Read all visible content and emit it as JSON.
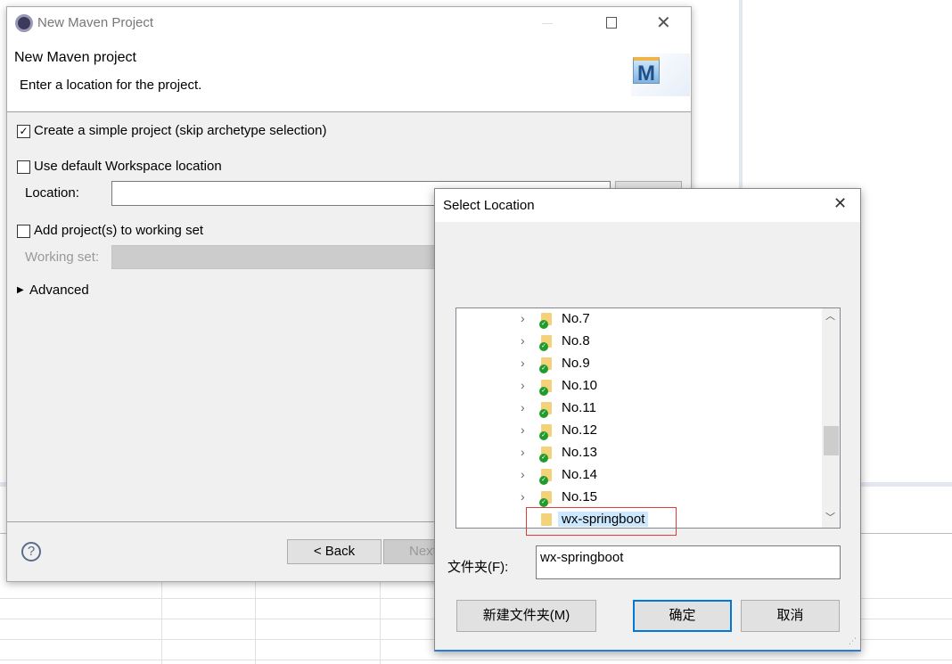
{
  "main_dialog": {
    "title": "New Maven Project",
    "heading": "New Maven project",
    "subheading": "Enter a location for the project.",
    "create_simple": {
      "label": "Create a simple project (skip archetype selection)",
      "checked": true
    },
    "use_default": {
      "label": "Use default Workspace location",
      "checked": false
    },
    "location_label": "Location:",
    "location_value": "",
    "add_working_set": {
      "label": "Add project(s) to working set",
      "checked": false
    },
    "working_set_label": "Working set:",
    "advanced": "Advanced",
    "back": "< Back",
    "next": "Next",
    "maven_logo": "M"
  },
  "select_dialog": {
    "title": "Select Location",
    "tree": [
      {
        "label": "No.7",
        "synced": true
      },
      {
        "label": "No.8",
        "synced": true
      },
      {
        "label": "No.9",
        "synced": true
      },
      {
        "label": "No.10",
        "synced": true
      },
      {
        "label": "No.11",
        "synced": true
      },
      {
        "label": "No.12",
        "synced": true
      },
      {
        "label": "No.13",
        "synced": true
      },
      {
        "label": "No.14",
        "synced": true
      },
      {
        "label": "No.15",
        "synced": true
      },
      {
        "label": "wx-springboot",
        "synced": false,
        "selected": true
      }
    ],
    "folder_label": "文件夹(F):",
    "folder_value": "wx-springboot",
    "new_folder": "新建文件夹(M)",
    "ok": "确定",
    "cancel": "取消"
  }
}
